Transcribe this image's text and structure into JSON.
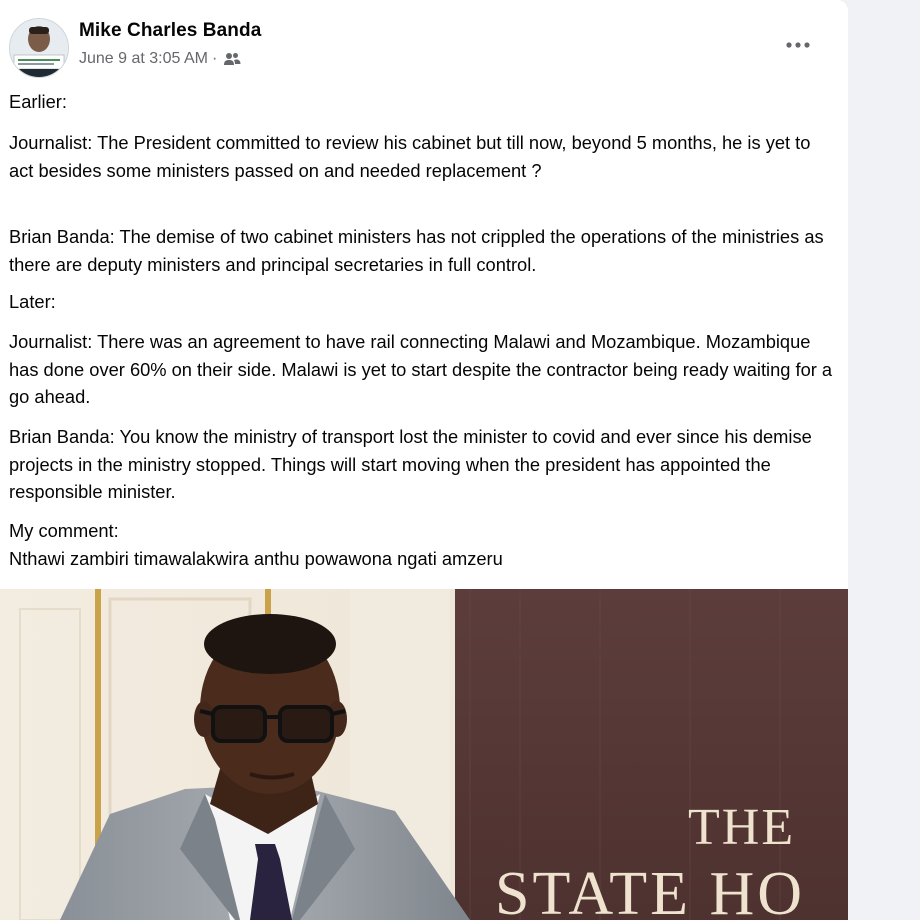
{
  "post": {
    "author": "Mike Charles Banda",
    "timestamp": "June 9 at 3:05 AM",
    "separator": "·",
    "audience_icon": "friends-icon",
    "more_icon": "more-horizontal-icon",
    "paragraphs": {
      "earlier": "Earlier:",
      "journalist_1": "Journalist: The President committed to review his cabinet but till now, beyond 5 months, he is yet to act besides some ministers passed on and needed replacement ?",
      "brian_1": "Brian Banda: The demise of two cabinet ministers has not crippled the operations of the ministries as there are deputy ministers and principal secretaries in full control.",
      "later": "Later:",
      "journalist_2": "Journalist: There was an agreement to have rail connecting Malawi and Mozambique. Mozambique has done over 60% on their side. Malawi is yet to start despite the contractor being ready waiting for a go ahead.",
      "brian_2": "Brian Banda: You know the ministry of transport lost the minister to covid and ever since his demise projects in the ministry stopped. Things will start moving when the president has appointed the responsible minister.",
      "comment_label": "My comment:",
      "comment_text": "Nthawi zambiri timawalakwira anthu powawona ngati amzeru"
    },
    "photo": {
      "sign_text_line1": "THE",
      "sign_text_line2": "STATE HO"
    }
  },
  "colors": {
    "page_bg": "#f0f2f5",
    "card_bg": "#ffffff",
    "text_primary": "#050505",
    "text_secondary": "#65676b",
    "sign_bg": "#5a3a38",
    "sign_text": "#efe3d0"
  }
}
